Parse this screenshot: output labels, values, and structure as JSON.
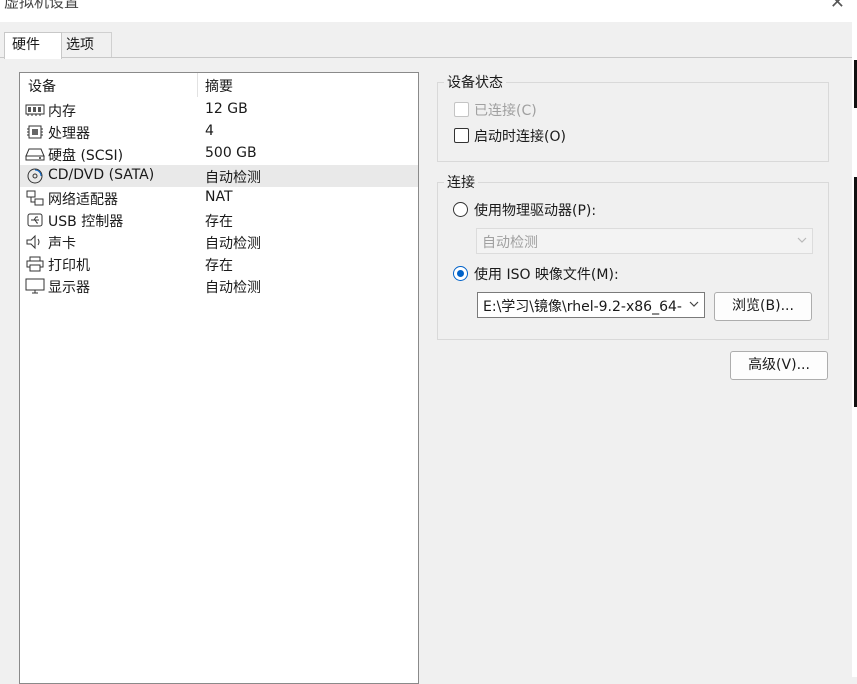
{
  "window": {
    "title": "虚拟机设置",
    "close_glyph": "✕"
  },
  "tabs": [
    {
      "label": "硬件"
    },
    {
      "label": "选项"
    }
  ],
  "device_list": {
    "headers": {
      "device": "设备",
      "summary": "摘要"
    },
    "rows": [
      {
        "name": "内存",
        "summary": "12 GB",
        "icon": "memory-icon"
      },
      {
        "name": "处理器",
        "summary": "4",
        "icon": "processor-icon"
      },
      {
        "name": "硬盘 (SCSI)",
        "summary": "500 GB",
        "icon": "hard-disk-icon"
      },
      {
        "name": "CD/DVD (SATA)",
        "summary": "自动检测",
        "icon": "cd-dvd-icon",
        "selected": true
      },
      {
        "name": "网络适配器",
        "summary": "NAT",
        "icon": "network-adapter-icon"
      },
      {
        "name": "USB 控制器",
        "summary": "存在",
        "icon": "usb-icon"
      },
      {
        "name": "声卡",
        "summary": "自动检测",
        "icon": "speaker-icon"
      },
      {
        "name": "打印机",
        "summary": "存在",
        "icon": "printer-icon"
      },
      {
        "name": "显示器",
        "summary": "自动检测",
        "icon": "display-icon"
      }
    ]
  },
  "device_status": {
    "title": "设备状态",
    "connected_label": "已连接(C)",
    "connected_checked": false,
    "connected_enabled": false,
    "connect_at_power_on_label": "启动时连接(O)",
    "connect_at_power_on_checked": false
  },
  "connection": {
    "title": "连接",
    "physical_drive_label": "使用物理驱动器(P):",
    "physical_drive_value": "自动检测",
    "iso_label": "使用 ISO 映像文件(M):",
    "iso_path": "E:\\学习\\镜像\\rhel-9.2-x86_64-",
    "browse_label": "浏览(B)...",
    "selected": "iso"
  },
  "advanced_label": "高级(V)...",
  "colors": {
    "accent": "#0062c9",
    "selected_row": "#e9e9e9"
  }
}
